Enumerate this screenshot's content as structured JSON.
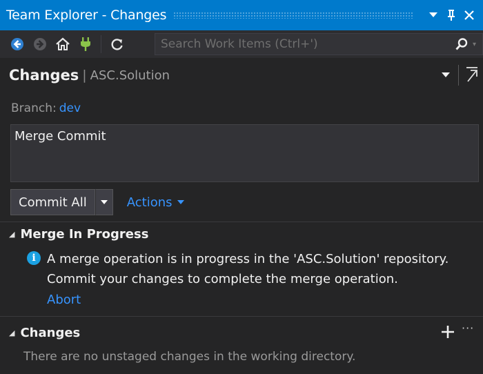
{
  "window": {
    "title": "Team Explorer - Changes"
  },
  "toolbar": {
    "buttons": [
      "back-icon",
      "forward-icon",
      "home-icon",
      "connect-icon",
      "refresh-icon"
    ],
    "search_placeholder": "Search Work Items (Ctrl+')"
  },
  "header": {
    "title": "Changes",
    "separator": "|",
    "subtitle": "ASC.Solution"
  },
  "branch": {
    "label": "Branch:",
    "value": "dev"
  },
  "commit": {
    "message": "Merge Commit",
    "button_label": "Commit All",
    "actions_label": "Actions"
  },
  "merge_section": {
    "title": "Merge In Progress",
    "message_line1": "A merge operation is in progress in the 'ASC.Solution' repository.",
    "message_line2": "Commit your changes to complete the merge operation.",
    "abort_label": "Abort"
  },
  "changes_section": {
    "title": "Changes",
    "more_label": "···",
    "empty_message": "There are no unstaged changes in the working directory."
  },
  "colors": {
    "accent": "#007acc",
    "link": "#3794ff",
    "background": "#252526"
  }
}
